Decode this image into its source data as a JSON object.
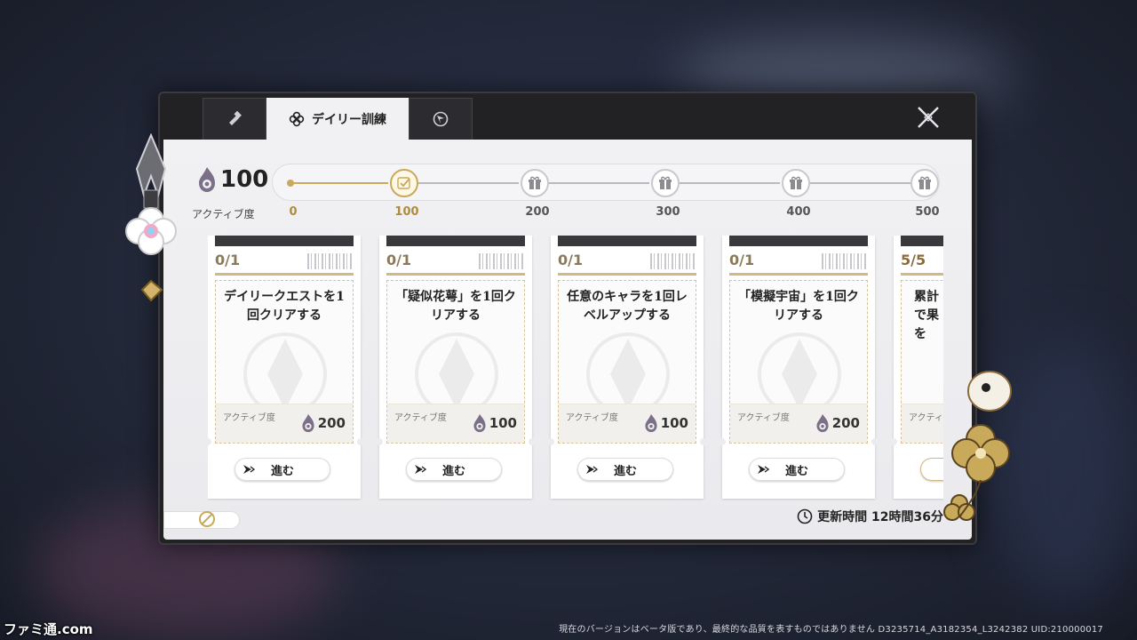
{
  "tabs": [
    {
      "icon": "wrench-icon"
    },
    {
      "icon": "clover-icon",
      "label": "デイリー訓練",
      "active": true
    },
    {
      "icon": "compass-icon"
    }
  ],
  "activity": {
    "value": "100",
    "label": "アクティブ度",
    "progress_fraction": 0.2,
    "milestones": [
      {
        "label": "0",
        "reached": true
      },
      {
        "label": "100",
        "reached": true
      },
      {
        "label": "200",
        "reached": false
      },
      {
        "label": "300",
        "reached": false
      },
      {
        "label": "400",
        "reached": false
      },
      {
        "label": "500",
        "reached": false
      }
    ]
  },
  "quests": [
    {
      "count": "0/1",
      "title": "デイリークエストを1回クリアする",
      "points_label": "アクティブ度",
      "points": "200",
      "button": "進む"
    },
    {
      "count": "0/1",
      "title": "「疑似花萼」を1回クリアする",
      "points_label": "アクティブ度",
      "points": "100",
      "button": "進む"
    },
    {
      "count": "0/1",
      "title": "任意のキャラを1回レベルアップする",
      "points_label": "アクティブ度",
      "points": "100",
      "button": "進む"
    },
    {
      "count": "0/1",
      "title": "「模擬宇宙」を1回クリアする",
      "points_label": "アクティブ度",
      "points": "200",
      "button": "進む"
    },
    {
      "count": "5/5",
      "title": "累計で果を",
      "points_label": "アクティブ度",
      "points": "",
      "button": ""
    }
  ],
  "refresh": {
    "text": "更新時間 12時間36分"
  },
  "footer": {
    "note": "現在のバージョンはベータ版であり、最終的な品質を表すものではありません  D3235714_A3182354_L3242382  UID:210000017"
  },
  "watermark": {
    "text": "ファミ通.com"
  },
  "colors": {
    "accent_gold": "#c9a95a",
    "panel_dark": "#222225",
    "panel_light": "#f1f1f3"
  }
}
